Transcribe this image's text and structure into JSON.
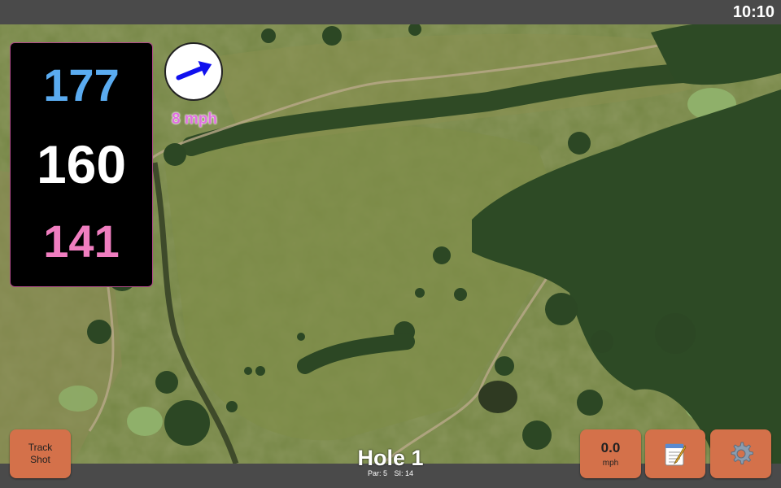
{
  "status": {
    "time": "10:10"
  },
  "distances": {
    "back": "177",
    "middle": "160",
    "front": "141"
  },
  "wind": {
    "speed_label": "8 mph",
    "icon": "wind-arrow-icon",
    "arrow_color": "#1010ee"
  },
  "buttons": {
    "track_shot": "Track\nShot",
    "speed_value": "0.0",
    "speed_unit": "mph",
    "notes_icon": "notepad-icon",
    "settings_icon": "gear-icon"
  },
  "hole": {
    "title": "Hole 1",
    "par": "Par: 5",
    "si": "SI: 14"
  },
  "colors": {
    "back_distance": "#5aabf0",
    "middle_distance": "#ffffff",
    "front_distance": "#f07ec0",
    "button": "#d4714a",
    "bar": "#4a4a4a"
  }
}
